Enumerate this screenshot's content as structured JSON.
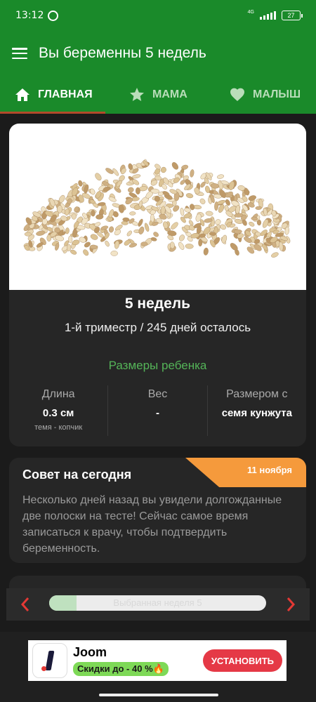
{
  "status_bar": {
    "time": "13:12",
    "network": "4G",
    "battery": "27"
  },
  "app_bar": {
    "title": "Вы беременны 5 недель",
    "menu_icon": "menu-icon"
  },
  "tabs": [
    {
      "label": "ГЛАВНАЯ",
      "icon": "home-icon",
      "selected": true
    },
    {
      "label": "МАМА",
      "icon": "star-icon",
      "selected": false
    },
    {
      "label": "МАЛЫШ",
      "icon": "heart-icon",
      "selected": false
    }
  ],
  "week_card": {
    "image": "sesame-seeds-image",
    "week_title": "5 недель",
    "trimester": "1-й триместр / 245 дней осталось",
    "sizes_title": "Размеры ребенка",
    "stats": [
      {
        "label": "Длина",
        "value": "0.3 см",
        "sub": "темя - копчик"
      },
      {
        "label": "Вес",
        "value": "-",
        "sub": ""
      },
      {
        "label": "Размером с",
        "value": "семя кунжута",
        "sub": ""
      }
    ]
  },
  "tip_card": {
    "title": "Совет на сегодня",
    "date": "11 ноября",
    "body": "Несколько дней назад вы увидели долгожданные две полоски на тесте! Сейчас самое время записаться к врачу, чтобы подтвердить беременность."
  },
  "week_selector": {
    "label": "Выбранная неделя 5",
    "progress_fraction": 0.125
  },
  "ad": {
    "name": "Joom",
    "promo": "Скидки до -  40  %🔥",
    "button": "УСТАНОВИТЬ"
  },
  "colors": {
    "primary_green": "#1a8a2a",
    "accent_green": "#54b458",
    "tip_orange": "#f59a3c",
    "arrow_red": "#e53935"
  }
}
